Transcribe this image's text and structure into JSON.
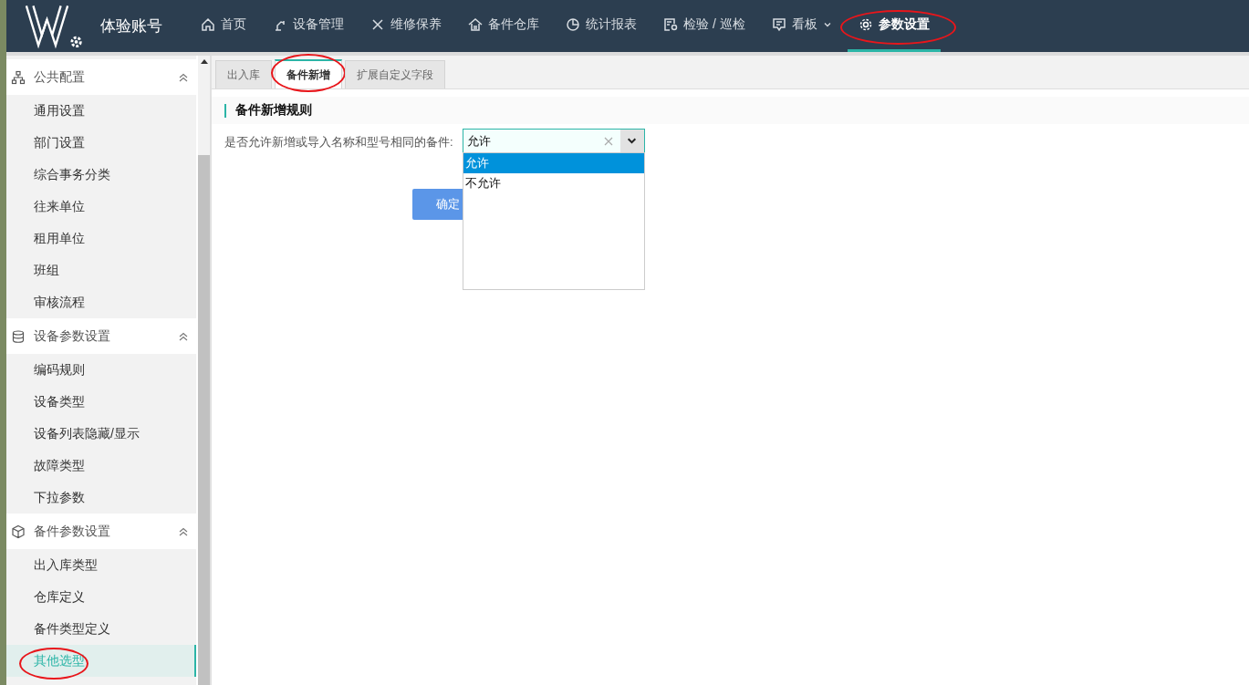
{
  "header": {
    "account": "体验账号"
  },
  "nav": [
    {
      "label": "首页",
      "selected": false,
      "circled": false,
      "dropdown": false
    },
    {
      "label": "设备管理",
      "selected": false,
      "circled": false,
      "dropdown": false
    },
    {
      "label": "维修保养",
      "selected": false,
      "circled": false,
      "dropdown": false
    },
    {
      "label": "备件仓库",
      "selected": false,
      "circled": false,
      "dropdown": false
    },
    {
      "label": "统计报表",
      "selected": false,
      "circled": false,
      "dropdown": false
    },
    {
      "label": "检验 / 巡检",
      "selected": false,
      "circled": false,
      "dropdown": false
    },
    {
      "label": "看板",
      "selected": false,
      "circled": false,
      "dropdown": true
    },
    {
      "label": "参数设置",
      "selected": true,
      "circled": true,
      "dropdown": false
    }
  ],
  "sidebar": {
    "groups": [
      {
        "label": "公共配置",
        "expanded": true,
        "items": [
          {
            "label": "通用设置",
            "selected": false,
            "circled": false
          },
          {
            "label": "部门设置",
            "selected": false,
            "circled": false
          },
          {
            "label": "综合事务分类",
            "selected": false,
            "circled": false
          },
          {
            "label": "往来单位",
            "selected": false,
            "circled": false
          },
          {
            "label": "租用单位",
            "selected": false,
            "circled": false
          },
          {
            "label": "班组",
            "selected": false,
            "circled": false
          },
          {
            "label": "审核流程",
            "selected": false,
            "circled": false
          }
        ]
      },
      {
        "label": "设备参数设置",
        "expanded": true,
        "items": [
          {
            "label": "编码规则",
            "selected": false,
            "circled": false
          },
          {
            "label": "设备类型",
            "selected": false,
            "circled": false
          },
          {
            "label": "设备列表隐藏/显示",
            "selected": false,
            "circled": false
          },
          {
            "label": "故障类型",
            "selected": false,
            "circled": false
          },
          {
            "label": "下拉参数",
            "selected": false,
            "circled": false
          }
        ]
      },
      {
        "label": "备件参数设置",
        "expanded": true,
        "items": [
          {
            "label": "出入库类型",
            "selected": false,
            "circled": false
          },
          {
            "label": "仓库定义",
            "selected": false,
            "circled": false
          },
          {
            "label": "备件类型定义",
            "selected": false,
            "circled": false
          },
          {
            "label": "其他选型",
            "selected": true,
            "circled": true
          }
        ]
      }
    ]
  },
  "tabs": [
    {
      "label": "出入库",
      "selected": false,
      "circled": false
    },
    {
      "label": "备件新增",
      "selected": true,
      "circled": true
    },
    {
      "label": "扩展自定义字段",
      "selected": false,
      "circled": false
    }
  ],
  "section": {
    "title": "备件新增规则"
  },
  "form": {
    "label": "是否允许新增或导入名称和型号相同的备件:",
    "value": "允许",
    "open": true,
    "options": [
      {
        "label": "允许",
        "selected": true
      },
      {
        "label": "不允许",
        "selected": false
      }
    ]
  },
  "buttons": [
    "确定"
  ]
}
